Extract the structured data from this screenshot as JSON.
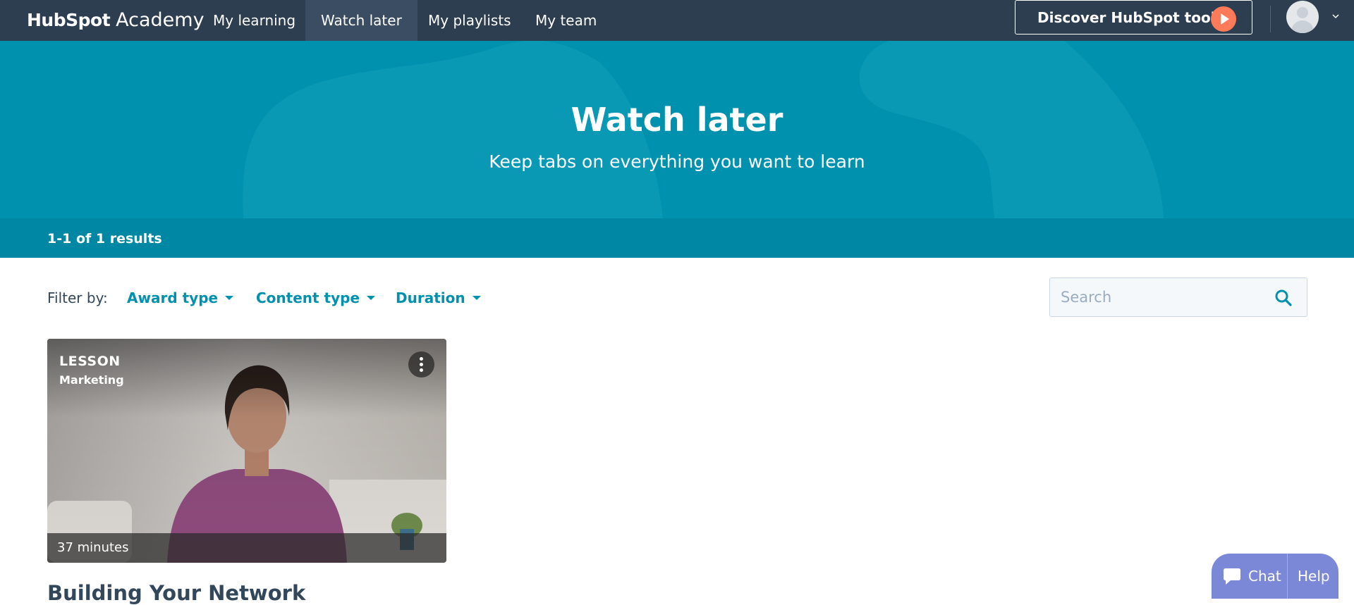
{
  "nav": {
    "logo_brand": "HubSpot",
    "logo_suffix": "Academy",
    "items": [
      {
        "label": "My learning",
        "active": false
      },
      {
        "label": "Watch later",
        "active": true
      },
      {
        "label": "My playlists",
        "active": false
      },
      {
        "label": "My team",
        "active": false
      }
    ],
    "discover_label": "Discover HubSpot tools"
  },
  "hero": {
    "title": "Watch later",
    "subtitle": "Keep tabs on everything you want to learn"
  },
  "results": {
    "summary": "1-1 of 1 results"
  },
  "filters": {
    "label": "Filter by:",
    "options": [
      "Award type",
      "Content type",
      "Duration"
    ]
  },
  "search": {
    "placeholder": "Search",
    "value": ""
  },
  "cards": [
    {
      "type": "LESSON",
      "category": "Marketing",
      "duration": "37 minutes",
      "title": "Building Your Network"
    }
  ],
  "chat": {
    "chat_label": "Chat",
    "help_label": "Help"
  },
  "colors": {
    "nav_bg": "#2d3e50",
    "hero_bg": "#0091ae",
    "accent": "#0091ae",
    "cta_orange": "#ff7a59",
    "chat_bg": "#7b88d8"
  }
}
